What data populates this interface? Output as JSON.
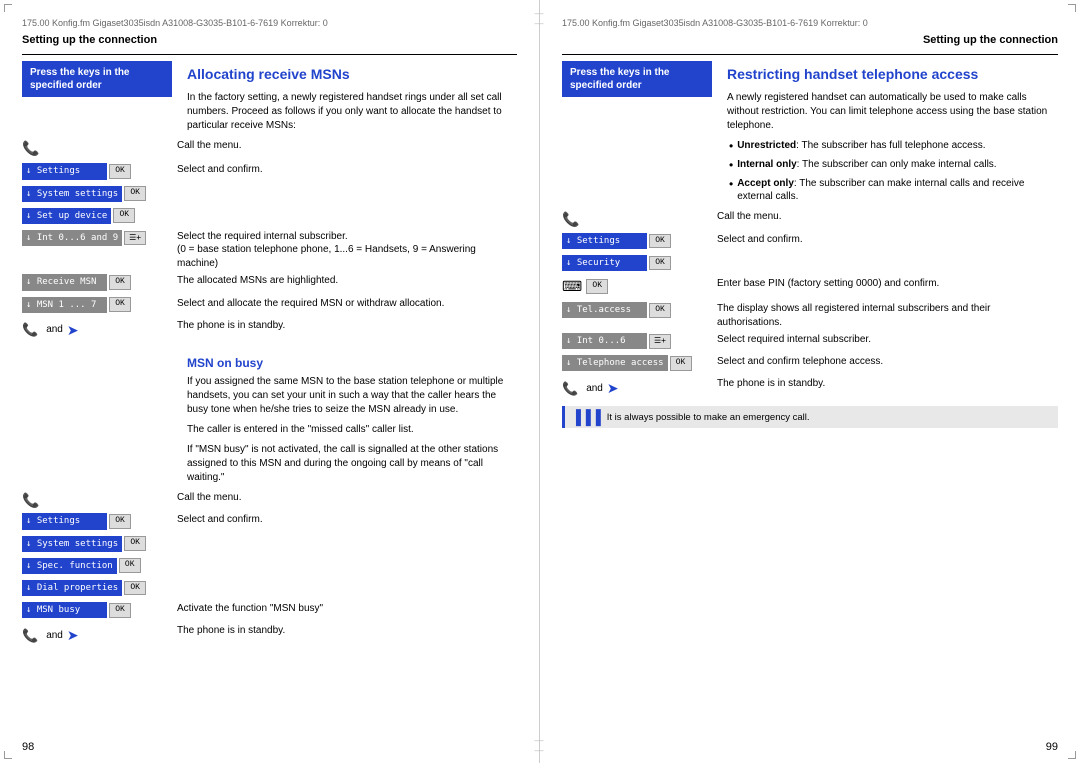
{
  "left_page": {
    "meta": {
      "left": "175.00    Konfig.fm    Gigaset3035isdn    A31008-G3035-B101-6-7619    Korrektur: 0"
    },
    "section_heading": "Setting up the connection",
    "blue_box": "Press the keys in the specified order",
    "subsection1": {
      "title": "Allocating receive MSNs",
      "intro": "In the factory setting, a newly registered handset rings under all set call numbers. Proceed as follows if you only want to allocate the handset to particular receive MSNs:",
      "steps": [
        {
          "menu": "Settings",
          "ok": "OK",
          "instruction": "Call the menu."
        },
        {
          "menu": "System settings",
          "ok": "OK",
          "instruction": "Select and confirm."
        },
        {
          "menu": "Set up device",
          "ok": "OK",
          "instruction": ""
        },
        {
          "menu": "Int 0...6 and 9",
          "ok": "",
          "instruction": "Select the required internal subscriber.\n(0 = base station telephone phone, 1...6 = Handsets, 9 = Answering machine)"
        },
        {
          "menu": "Receive MSN",
          "ok": "OK",
          "instruction": "The allocated MSNs are highlighted."
        },
        {
          "menu": "MSN 1 ... 7",
          "ok": "OK",
          "instruction": "Select and allocate the required MSN or withdraw allocation."
        }
      ],
      "and_text": "and",
      "standby": "The phone is in standby."
    },
    "subsection2": {
      "title": "MSN on busy",
      "body1": "If you assigned the same MSN to the base station telephone or multiple handsets, you can set your unit in such a way that the caller hears the busy tone when he/she tries to seize the MSN already in use.",
      "body2": "The caller is entered in the \"missed calls\" caller list.",
      "body3": "If \"MSN busy\" is not activated, the call is signalled at the other stations assigned to this MSN and during the ongoing call by means of \"call waiting.\"",
      "steps": [
        {
          "menu": "Settings",
          "ok": "OK",
          "instruction": "Call the menu."
        },
        {
          "menu": "System settings",
          "ok": "OK",
          "instruction": "Select and confirm."
        },
        {
          "menu": "Spec. function",
          "ok": "OK",
          "instruction": ""
        },
        {
          "menu": "Dial properties",
          "ok": "OK",
          "instruction": ""
        },
        {
          "menu": "MSN busy",
          "ok": "OK",
          "instruction": "Activate the function \"MSN busy\""
        }
      ],
      "and_text": "and",
      "standby": "The phone is in standby."
    },
    "page_number": "98"
  },
  "right_page": {
    "meta": {
      "right": "175.00    Konfig.fm    Gigaset3035isdn    A31008-G3035-B101-6-7619    Korrektur: 0"
    },
    "section_heading": "Setting up the connection",
    "blue_box": "Press the keys in the specified order",
    "subsection1": {
      "title": "Restricting handset telephone access",
      "intro": "A newly registered handset can automatically be used to make calls without restriction. You can limit telephone access using the base station telephone.",
      "bullets": [
        {
          "term": "Unrestricted",
          "desc": ": The subscriber has full telephone access."
        },
        {
          "term": "Internal only",
          "desc": ": The subscriber can only make internal calls."
        },
        {
          "term": "Accept only",
          "desc": ": The subscriber can make internal calls and receive external calls."
        }
      ],
      "steps": [
        {
          "menu": "Settings",
          "ok": "OK",
          "icon": "phone",
          "instruction": "Call the menu."
        },
        {
          "menu": "Security",
          "ok": "OK",
          "instruction": "Select and confirm."
        },
        {
          "menu": "",
          "ok": "OK",
          "icon": "grid",
          "instruction": "Enter base PIN (factory setting 0000) and confirm."
        },
        {
          "menu": "Tel.access",
          "ok": "OK",
          "instruction": "The display shows all registered internal subscribers and their authorisations."
        },
        {
          "menu": "Int 0...6",
          "ok": "",
          "icon": "nav",
          "instruction": "Select required internal subscriber."
        },
        {
          "menu": "Telephone access",
          "ok": "OK",
          "instruction": "Select and confirm telephone access."
        }
      ],
      "and_text": "and",
      "standby": "The phone is in standby.",
      "info_bar": "It is always possible to make an emergency call."
    },
    "page_number": "99"
  }
}
